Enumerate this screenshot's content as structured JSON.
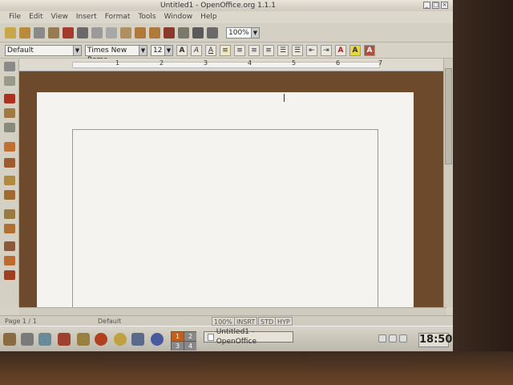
{
  "window": {
    "title": "Untitled1 - OpenOffice.org 1.1.1",
    "controls": [
      "_",
      "□",
      "×"
    ]
  },
  "menu": [
    "File",
    "Edit",
    "View",
    "Insert",
    "Format",
    "Tools",
    "Window",
    "Help"
  ],
  "toolbar": {
    "zoom": "100%",
    "icons": [
      "new-icon",
      "open-icon",
      "save-icon",
      "edit-icon",
      "export-pdf-icon",
      "print-icon",
      "cut-icon",
      "copy-icon",
      "paste-icon",
      "undo-icon",
      "redo-icon",
      "navigator-icon",
      "gallery-icon",
      "datasource-icon",
      "page-icon"
    ]
  },
  "format": {
    "style": "Default",
    "font": "Times New Roma",
    "size": "12",
    "bold": "A",
    "italic": "A",
    "underline": "A",
    "font_color": "A",
    "highlight": "A",
    "char_bg": "A"
  },
  "ruler": {
    "numbers": [
      "1",
      "2",
      "3",
      "4",
      "5",
      "6",
      "7"
    ]
  },
  "status": {
    "page": "Page 1 / 1",
    "style": "Default",
    "zoom": "100%",
    "insert": "INSRT",
    "std": "STD",
    "hyp": "HYP"
  },
  "taskbar": {
    "pager": [
      "1",
      "2",
      "3",
      "4"
    ],
    "task_label": "Untitled1 - OpenOffice",
    "clock": "18:50"
  },
  "colors": {
    "doc_background": "#6e4a2c",
    "page": "#f4f3ef",
    "chrome": "#d6d2c6"
  }
}
